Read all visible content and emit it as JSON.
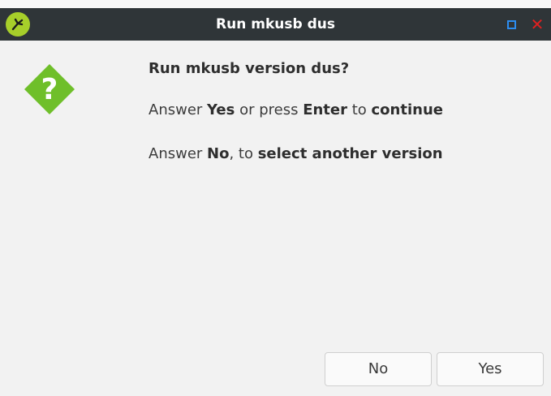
{
  "window": {
    "title": "Run mkusb dus"
  },
  "message": {
    "title": "Run mkusb version dus?",
    "line1": {
      "prefix": "Answer ",
      "yes": "Yes",
      "mid": " or press ",
      "enter": "Enter",
      "to": " to ",
      "continue": "continue"
    },
    "line2": {
      "prefix": "Answer ",
      "no": "No",
      "mid": ", to ",
      "action": "select another version"
    }
  },
  "buttons": {
    "no": "No",
    "yes": "Yes"
  },
  "icons": {
    "app": "mkusb-app-icon",
    "dialog": "question-icon"
  },
  "colors": {
    "titlebar": "#2f3538",
    "app_icon": "#a7cf2a",
    "question_icon": "#6fbf2a",
    "close": "#e02020",
    "maximize": "#2c8df0"
  }
}
